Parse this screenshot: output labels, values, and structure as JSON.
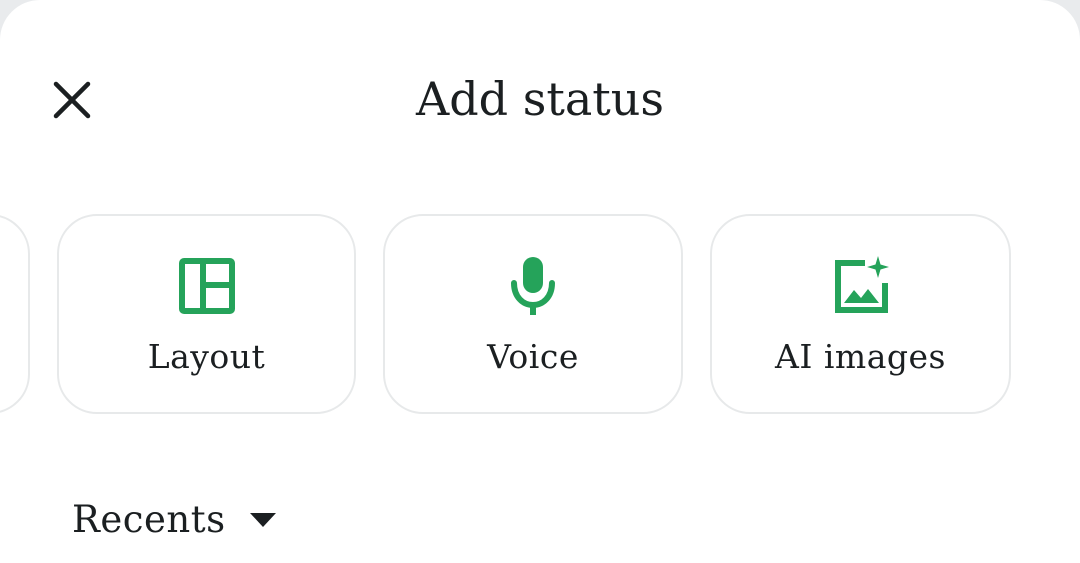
{
  "sheet": {
    "title": "Add status"
  },
  "icons": {
    "close": "close-icon",
    "layout": "layout-icon",
    "voice": "microphone-icon",
    "ai_images": "ai-image-sparkle-icon",
    "recents_caret": "caret-down-icon"
  },
  "options": [
    {
      "label": "Layout"
    },
    {
      "label": "Voice"
    },
    {
      "label": "AI images"
    }
  ],
  "recents": {
    "label": "Recents"
  },
  "colors": {
    "accent": "#25a35a",
    "text": "#1b1f21",
    "card_border": "#e7e9ea"
  }
}
